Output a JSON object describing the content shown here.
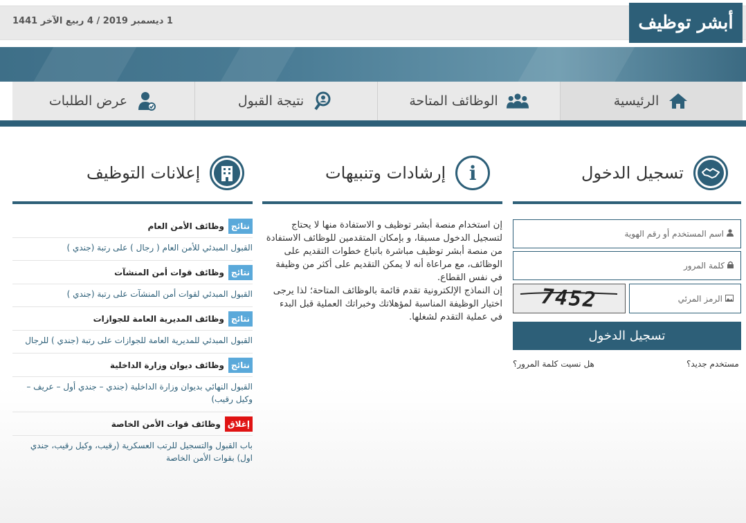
{
  "header": {
    "date": "1 ديسمبر 2019 / 4 ربيع الآخر 1441",
    "logo_text": "أبشر توظيف"
  },
  "nav": {
    "items": [
      {
        "label": "الرئيسية",
        "icon": "home-icon"
      },
      {
        "label": "الوظائف المتاحة",
        "icon": "group-icon"
      },
      {
        "label": "نتيجة القبول",
        "icon": "search-person-icon"
      },
      {
        "label": "عرض الطلبات",
        "icon": "user-check-icon"
      }
    ]
  },
  "login": {
    "title": "تسجيل الدخول",
    "username_placeholder": "اسم المستخدم أو رقم الهوية",
    "password_placeholder": "كلمة المرور",
    "captcha_placeholder": "الرمز المرئي",
    "captcha_value": "7452",
    "submit_label": "تسجيل الدخول",
    "new_user_link": "مستخدم جديد؟",
    "forgot_password_link": "هل نسيت كلمة المرور؟"
  },
  "guidance": {
    "title": "إرشادات وتنبيهات",
    "paragraph_1": "إن استخدام منصة أبشر توظيف و الاستفادة منها لا يحتاج لتسجيل الدخول مسبقا، و بإمكان المتقدمين للوظائف الاستفادة من منصة أبشر توظيف مباشرة باتباع خطوات التقديم على الوظائف، مع مراعاة أنه لا يمكن التقديم على أكثر من وظيفة في نفس القطاع.",
    "paragraph_2": "إن النماذج الإلكترونية تقدم قائمة بالوظائف المتاحة؛ لذا يرجى اختيار الوظيفة المناسبة لمؤهلاتك وخبراتك العملية قبل البدء في عملية التقدم لشغلها."
  },
  "announcements": {
    "title": "إعلانات التوظيف",
    "items": [
      {
        "badge": "نتائج",
        "status": "results",
        "title": "وظائف الأمن العام",
        "body": "القبول المبدئي للأمن العام ( رجال ) على رتبة (جندي )"
      },
      {
        "badge": "نتائج",
        "status": "results",
        "title": "وظائف قوات أمن المنشآت",
        "body": "القبول المبدئي لقوات أمن المنشآت على رتبة (جندي )"
      },
      {
        "badge": "نتائج",
        "status": "results",
        "title": "وظائف المديرية العامة للجوازات",
        "body": "القبول المبدئي للمديرية العامة للجوازات على رتبة (جندي ) للرجال"
      },
      {
        "badge": "نتائج",
        "status": "results",
        "title": "وظائف ديوان وزارة الداخلية",
        "body": "القبول النهائي بديوان وزارة الداخلية (جندي – جندي أول – عريف – وكيل رقيب)"
      },
      {
        "badge": "إغلاق",
        "status": "closed",
        "title": "وظائف قوات الأمن الخاصة",
        "body": "باب القبول والتسجيل للرتب العسكرية (رقيب، وكيل رقيب، جندي اول) بقوات الأمن الخاصة"
      }
    ]
  },
  "colors": {
    "primary": "#2d5f78",
    "results_badge": "#5aa9da",
    "closed_badge": "#e01313"
  }
}
